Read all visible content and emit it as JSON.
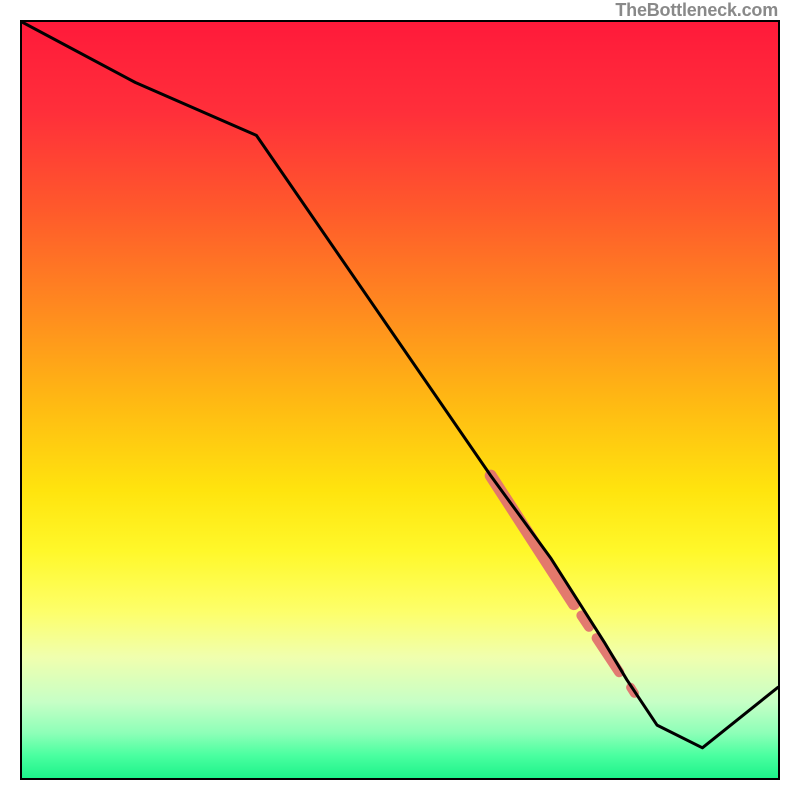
{
  "watermark": "TheBottleneck.com",
  "chart_data": {
    "type": "line",
    "title": "",
    "xlabel": "",
    "ylabel": "",
    "xlim": [
      0,
      100
    ],
    "ylim": [
      0,
      100
    ],
    "x": [
      0,
      15,
      31,
      62,
      70,
      77,
      80,
      84,
      90,
      100
    ],
    "values": [
      100,
      92,
      85,
      40,
      29,
      18,
      13,
      7,
      4,
      12
    ],
    "gradient_stops": [
      {
        "offset": 0.0,
        "color": "#ff1a3a"
      },
      {
        "offset": 0.12,
        "color": "#ff2f3a"
      },
      {
        "offset": 0.25,
        "color": "#ff5a2b"
      },
      {
        "offset": 0.38,
        "color": "#ff8a1f"
      },
      {
        "offset": 0.5,
        "color": "#ffb813"
      },
      {
        "offset": 0.62,
        "color": "#ffe40e"
      },
      {
        "offset": 0.7,
        "color": "#fff82a"
      },
      {
        "offset": 0.78,
        "color": "#fdff6a"
      },
      {
        "offset": 0.84,
        "color": "#f0ffae"
      },
      {
        "offset": 0.9,
        "color": "#c6ffc6"
      },
      {
        "offset": 0.94,
        "color": "#8effb8"
      },
      {
        "offset": 0.97,
        "color": "#4affa0"
      },
      {
        "offset": 1.0,
        "color": "#1df38a"
      }
    ],
    "overlay_segments": [
      {
        "x1": 62,
        "y1": 40,
        "x2": 73,
        "y2": 23,
        "width": 12
      },
      {
        "x1": 74,
        "y1": 21.5,
        "x2": 75,
        "y2": 20,
        "width": 10
      },
      {
        "x1": 76,
        "y1": 18.5,
        "x2": 79,
        "y2": 14,
        "width": 10
      },
      {
        "x1": 80.5,
        "y1": 12,
        "x2": 81,
        "y2": 11.2,
        "width": 9
      }
    ],
    "overlay_color": "#e2736f"
  }
}
